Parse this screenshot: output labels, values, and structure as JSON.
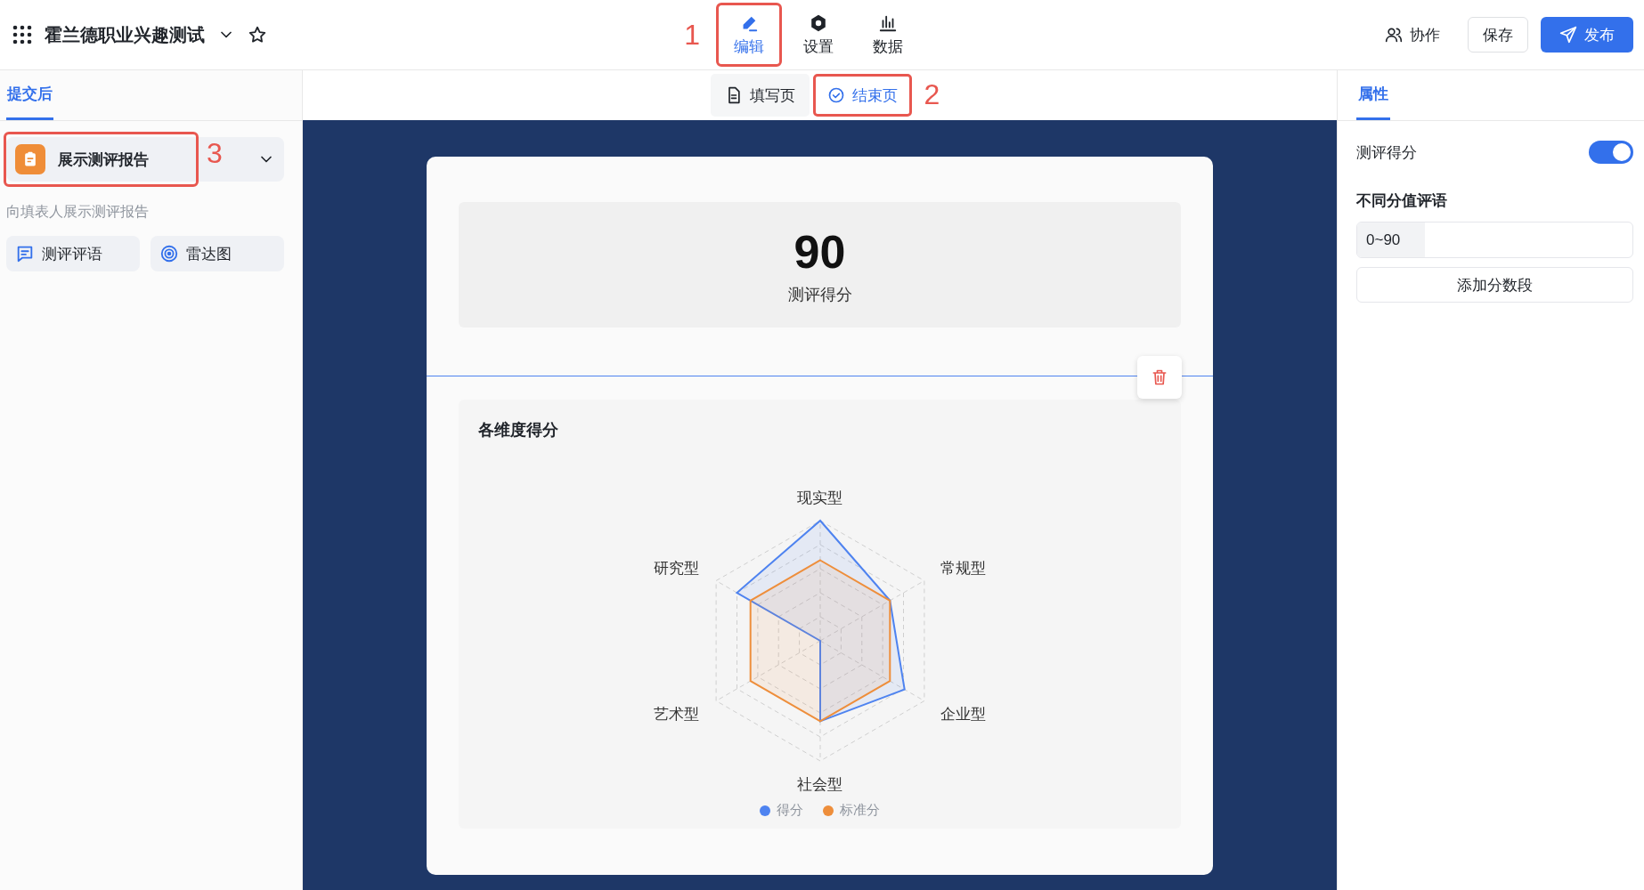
{
  "app": {
    "title": "霍兰德职业兴趣测试",
    "starred": false
  },
  "mode_tabs": [
    {
      "label": "编辑",
      "kind": "edit",
      "selected": true,
      "highlighted": true,
      "callout": "1"
    },
    {
      "label": "设置",
      "kind": "settings",
      "selected": false,
      "highlighted": false
    },
    {
      "label": "数据",
      "kind": "data",
      "selected": false,
      "highlighted": false
    }
  ],
  "actions": [
    {
      "label": "协作",
      "kind": "collab"
    },
    {
      "label": "保存",
      "kind": "save"
    },
    {
      "label": "发布",
      "kind": "publish"
    }
  ],
  "sidebar": {
    "tabs": [
      {
        "label": "提交后",
        "selected": true
      }
    ],
    "block": {
      "label": "展示测评报告",
      "highlighted": true,
      "callout": "3",
      "expanded": false
    },
    "description": "向填表人展示测评报告",
    "components": [
      {
        "label": "测评评语",
        "kind": "comment"
      },
      {
        "label": "雷达图",
        "kind": "radar"
      }
    ]
  },
  "page_tabs": [
    {
      "label": "填写页",
      "kind": "form",
      "selected": false,
      "highlighted": false
    },
    {
      "label": "结束页",
      "kind": "end",
      "selected": true,
      "highlighted": true,
      "callout": "2"
    }
  ],
  "canvas": {
    "score": "90",
    "score_label": "测评得分",
    "chart_card": {
      "title": "各维度得分",
      "axes": [
        "现实型",
        "常规型",
        "企业型",
        "社会型",
        "艺术型",
        "研究型"
      ],
      "legend": [
        {
          "label": "得分",
          "color": "#4e83f0"
        },
        {
          "label": "标准分",
          "color": "#ee8e3b"
        }
      ]
    }
  },
  "properties": {
    "tabs": [
      {
        "label": "属性",
        "selected": true
      }
    ],
    "score_toggle": {
      "label": "测评得分",
      "on": true
    },
    "comments_title": "不同分值评语",
    "ranges": [
      {
        "range": "0~90"
      }
    ],
    "add_button": "添加分数段"
  }
}
